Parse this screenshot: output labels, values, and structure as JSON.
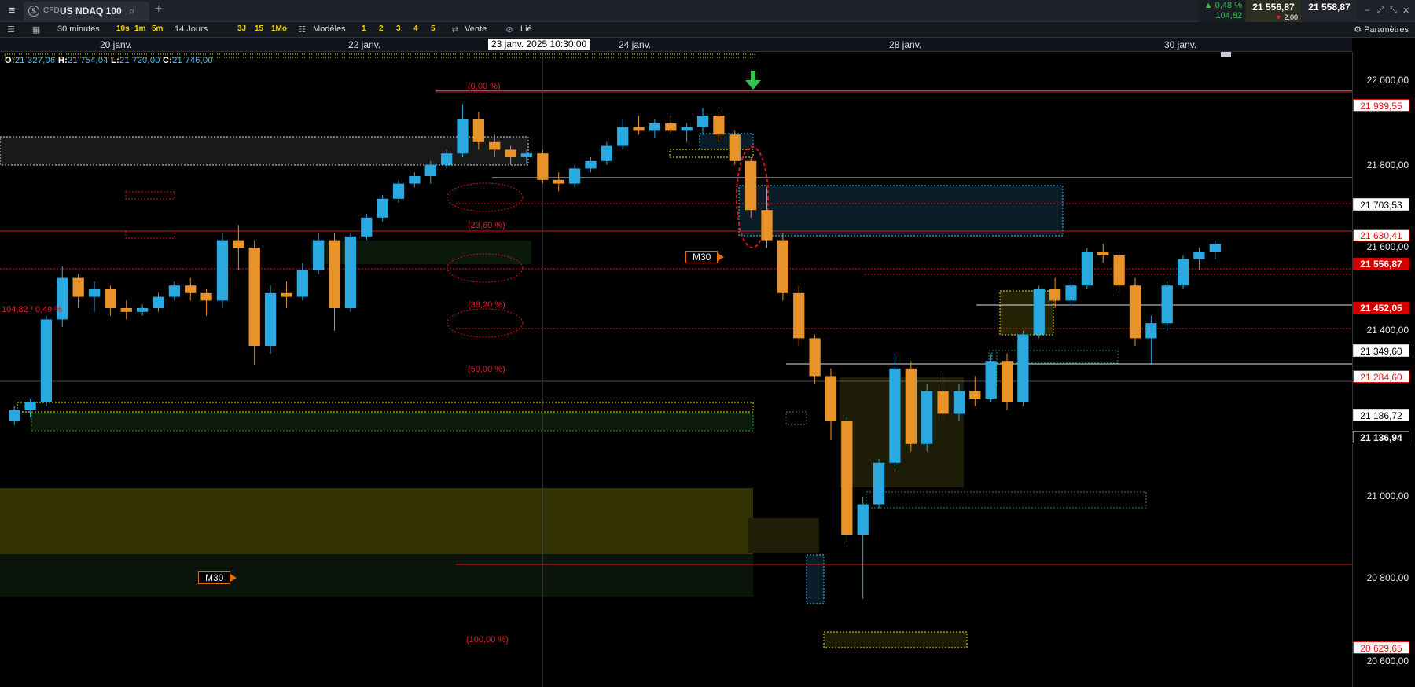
{
  "topbar": {
    "menu_icon": "hamburger-icon",
    "instrument_type": "CFD",
    "instrument_name": "US NDAQ 100",
    "change_pct": "▲ 0,48 %",
    "change_pts": "104,82",
    "bid": "21 556,87",
    "ask": "21 558,87",
    "spread": "2,00"
  },
  "toolbar": {
    "period": "30 minutes",
    "intervals": [
      "10s",
      "1m",
      "5m"
    ],
    "range": "14 Jours",
    "ranges": [
      "3J",
      "15",
      "1Mo"
    ],
    "models_label": "Modèles",
    "model_slots": [
      "1",
      "2",
      "3",
      "4",
      "5"
    ],
    "sell_label": "Vente",
    "linked_label": "Lié",
    "settings_label": "Paramètres"
  },
  "date_axis": {
    "labels": [
      "20 janv.",
      "22 janv.",
      "24 janv.",
      "28 janv.",
      "30 janv."
    ],
    "cursor_date": "23 janv. 2025 10:30:00"
  },
  "ohlc": {
    "o_label": "O:",
    "o_value": "21 327,06",
    "h_label": "H:",
    "h_value": "21 754,04",
    "l_label": "L:",
    "l_value": "21 720,00",
    "c_label": "C:",
    "c_value": "21 746,00"
  },
  "annotations": {
    "fib_0": "(0,00 %)",
    "fib_236": "(23,60 %)",
    "fib_382": "(38,20 %)",
    "fib_50": "(50,00 %)",
    "fib_100": "(100,00 %)",
    "m30_tag": "M30",
    "left_note": "104,82 / 0,49 %"
  },
  "price_axis": {
    "grid_labels": [
      "22 000,00",
      "21 800,00",
      "21 600,00",
      "21 400,00",
      "21 000,00",
      "20 800,00",
      "20 600,00"
    ],
    "tags": {
      "p21939": "21 939,55",
      "p21703": "21 703,53",
      "p21630": "21 630,41",
      "p21556": "21 556,87",
      "p21452": "21 452,05",
      "p21349": "21 349,60",
      "p21284": "21 284,60",
      "p21186": "21 186,72",
      "p21136": "21 136,94",
      "p20629": "20 629,65"
    }
  },
  "colors": {
    "up_candle": "#2aa9e0",
    "down_candle": "#e8922a",
    "fib_red": "#e01515",
    "zone_yellow": "#f2e200",
    "zone_green": "#1f8f2a",
    "zone_cyan": "#35c7ee"
  },
  "candles": [
    [
      21100,
      21140,
      21090,
      21130
    ],
    [
      21130,
      21160,
      21110,
      21150
    ],
    [
      21150,
      21380,
      21140,
      21370
    ],
    [
      21370,
      21510,
      21350,
      21480
    ],
    [
      21480,
      21490,
      21400,
      21430
    ],
    [
      21430,
      21470,
      21390,
      21450
    ],
    [
      21450,
      21460,
      21380,
      21400
    ],
    [
      21400,
      21420,
      21370,
      21390
    ],
    [
      21390,
      21410,
      21380,
      21400
    ],
    [
      21400,
      21440,
      21390,
      21430
    ],
    [
      21430,
      21470,
      21420,
      21460
    ],
    [
      21460,
      21480,
      21420,
      21440
    ],
    [
      21440,
      21450,
      21380,
      21420
    ],
    [
      21420,
      21600,
      21400,
      21580
    ],
    [
      21580,
      21620,
      21500,
      21560
    ],
    [
      21560,
      21580,
      21250,
      21300
    ],
    [
      21300,
      21460,
      21280,
      21440
    ],
    [
      21440,
      21470,
      21400,
      21430
    ],
    [
      21430,
      21520,
      21420,
      21500
    ],
    [
      21500,
      21600,
      21490,
      21580
    ],
    [
      21580,
      21600,
      21340,
      21400
    ],
    [
      21400,
      21600,
      21390,
      21590
    ],
    [
      21590,
      21650,
      21580,
      21640
    ],
    [
      21640,
      21700,
      21630,
      21690
    ],
    [
      21690,
      21740,
      21680,
      21730
    ],
    [
      21730,
      21760,
      21720,
      21750
    ],
    [
      21750,
      21790,
      21730,
      21780
    ],
    [
      21780,
      21820,
      21770,
      21810
    ],
    [
      21810,
      21940,
      21800,
      21900
    ],
    [
      21900,
      21920,
      21820,
      21840
    ],
    [
      21840,
      21860,
      21800,
      21820
    ],
    [
      21820,
      21830,
      21780,
      21800
    ],
    [
      21800,
      21820,
      21780,
      21810
    ],
    [
      21810,
      21820,
      21730,
      21740
    ],
    [
      21740,
      21760,
      21710,
      21730
    ],
    [
      21730,
      21780,
      21720,
      21770
    ],
    [
      21770,
      21800,
      21760,
      21790
    ],
    [
      21790,
      21840,
      21780,
      21830
    ],
    [
      21830,
      21900,
      21820,
      21880
    ],
    [
      21880,
      21910,
      21860,
      21870
    ],
    [
      21870,
      21900,
      21850,
      21890
    ],
    [
      21890,
      21910,
      21860,
      21870
    ],
    [
      21870,
      21890,
      21840,
      21880
    ],
    [
      21880,
      21930,
      21860,
      21910
    ],
    [
      21910,
      21920,
      21840,
      21860
    ],
    [
      21860,
      21870,
      21780,
      21790
    ],
    [
      21790,
      21800,
      21640,
      21660
    ],
    [
      21660,
      21720,
      21560,
      21580
    ],
    [
      21580,
      21600,
      21420,
      21440
    ],
    [
      21440,
      21460,
      21300,
      21320
    ],
    [
      21320,
      21330,
      21200,
      21220
    ],
    [
      21220,
      21240,
      21050,
      21100
    ],
    [
      21100,
      21110,
      20780,
      20800
    ],
    [
      20800,
      20900,
      20630,
      20880
    ],
    [
      20880,
      21000,
      20870,
      20990
    ],
    [
      20990,
      21280,
      20980,
      21240
    ],
    [
      21240,
      21260,
      21020,
      21040
    ],
    [
      21040,
      21200,
      21020,
      21180
    ],
    [
      21180,
      21230,
      21100,
      21120
    ],
    [
      21120,
      21200,
      21100,
      21180
    ],
    [
      21180,
      21220,
      21140,
      21160
    ],
    [
      21160,
      21280,
      21150,
      21260
    ],
    [
      21260,
      21280,
      21130,
      21150
    ],
    [
      21150,
      21340,
      21140,
      21330
    ],
    [
      21330,
      21460,
      21320,
      21450
    ],
    [
      21450,
      21480,
      21400,
      21420
    ],
    [
      21420,
      21470,
      21410,
      21460
    ],
    [
      21460,
      21560,
      21450,
      21550
    ],
    [
      21550,
      21570,
      21520,
      21540
    ],
    [
      21540,
      21550,
      21440,
      21460
    ],
    [
      21460,
      21480,
      21300,
      21320
    ],
    [
      21320,
      21380,
      21250,
      21360
    ],
    [
      21360,
      21470,
      21340,
      21460
    ],
    [
      21460,
      21540,
      21450,
      21530
    ],
    [
      21530,
      21560,
      21500,
      21550
    ],
    [
      21550,
      21580,
      21530,
      21570
    ]
  ]
}
